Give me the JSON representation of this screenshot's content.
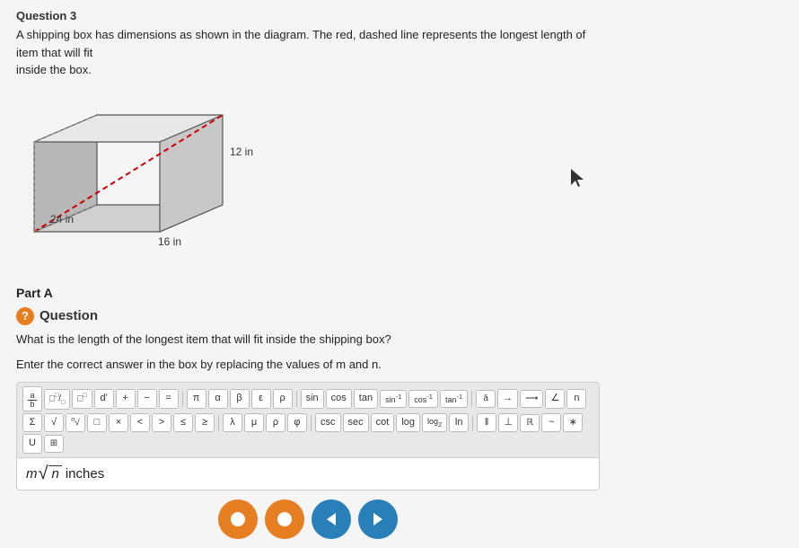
{
  "header": {
    "question_number": "Question 3"
  },
  "description": {
    "line1": "A shipping box has dimensions as shown in the diagram. The red, dashed line represents the longest length of item that will fit",
    "line2": "inside the box."
  },
  "diagram": {
    "dim_top": "12 in",
    "dim_bottom": "16 in",
    "dim_side": "24 in"
  },
  "part_a": {
    "label": "Part A"
  },
  "question": {
    "title": "Question",
    "text1": "What is the length of the longest item that will fit inside the shipping box?",
    "text2": "Enter the correct answer in the box by replacing the values of m and n."
  },
  "toolbar": {
    "buttons": [
      {
        "label": "a/b",
        "name": "fraction-btn"
      },
      {
        "label": "☐",
        "name": "square-btn"
      },
      {
        "label": "▣",
        "name": "rect-btn"
      },
      {
        "label": "d'",
        "name": "derivative-btn"
      },
      {
        "label": "+",
        "name": "plus-btn"
      },
      {
        "label": "-",
        "name": "minus-btn"
      },
      {
        "label": "=",
        "name": "equals-btn"
      },
      {
        "label": "π",
        "name": "pi-btn"
      },
      {
        "label": "α",
        "name": "alpha-btn"
      },
      {
        "label": "β",
        "name": "beta-btn"
      },
      {
        "label": "ε",
        "name": "epsilon-btn"
      },
      {
        "label": "ρ",
        "name": "rho-btn"
      },
      {
        "label": "sin",
        "name": "sin-btn"
      },
      {
        "label": "cos",
        "name": "cos-btn"
      },
      {
        "label": "tan",
        "name": "tan-btn"
      },
      {
        "label": "sin⁻¹",
        "name": "arcsin-btn"
      },
      {
        "label": "cos⁻¹",
        "name": "arccos-btn"
      },
      {
        "label": "tan⁻¹",
        "name": "arctan-btn"
      },
      {
        "label": "δ̄",
        "name": "delta-bar-btn"
      },
      {
        "label": "→",
        "name": "arrow-right-btn"
      },
      {
        "label": "—",
        "name": "long-arrow-btn"
      },
      {
        "label": "∠",
        "name": "angle-btn"
      },
      {
        "label": "n",
        "name": "n-btn"
      },
      {
        "label": "Σ",
        "name": "sigma-btn"
      },
      {
        "label": "√",
        "name": "sqrt-btn"
      },
      {
        "label": "∜",
        "name": "fourth-root-btn"
      },
      {
        "label": "□",
        "name": "box-btn"
      },
      {
        "label": "×",
        "name": "times-btn"
      },
      {
        "label": "<",
        "name": "less-btn"
      },
      {
        "label": ">",
        "name": "greater-btn"
      },
      {
        "label": "≤",
        "name": "leq-btn"
      },
      {
        "label": "≥",
        "name": "geq-btn"
      },
      {
        "label": "λ",
        "name": "lambda-btn"
      },
      {
        "label": "μ",
        "name": "mu-btn"
      },
      {
        "label": "ρ",
        "name": "rho2-btn"
      },
      {
        "label": "φ",
        "name": "phi-btn"
      },
      {
        "label": "csc",
        "name": "csc-btn"
      },
      {
        "label": "sec",
        "name": "sec-btn"
      },
      {
        "label": "cot",
        "name": "cot-btn"
      },
      {
        "label": "log",
        "name": "log-btn"
      },
      {
        "label": "log₂",
        "name": "log2-btn"
      },
      {
        "label": "ln",
        "name": "ln-btn"
      },
      {
        "label": "‖",
        "name": "parallel-btn"
      },
      {
        "label": "⊥",
        "name": "perp-btn"
      },
      {
        "label": "ℝ",
        "name": "real-btn"
      },
      {
        "label": "~",
        "name": "tilde-btn"
      },
      {
        "label": "*",
        "name": "star-btn"
      },
      {
        "label": "U",
        "name": "union-btn"
      },
      {
        "label": "⊞",
        "name": "matrix-btn"
      }
    ]
  },
  "answer": {
    "prefix": "m",
    "sqrt_content": "n",
    "suffix": "inches",
    "placeholder": ""
  },
  "nav_buttons": [
    {
      "label": "●",
      "color": "orange",
      "name": "btn1"
    },
    {
      "label": "●",
      "color": "orange",
      "name": "btn2"
    },
    {
      "label": "◀",
      "color": "blue",
      "name": "back-btn"
    },
    {
      "label": "▶",
      "color": "blue",
      "name": "forward-btn"
    }
  ]
}
